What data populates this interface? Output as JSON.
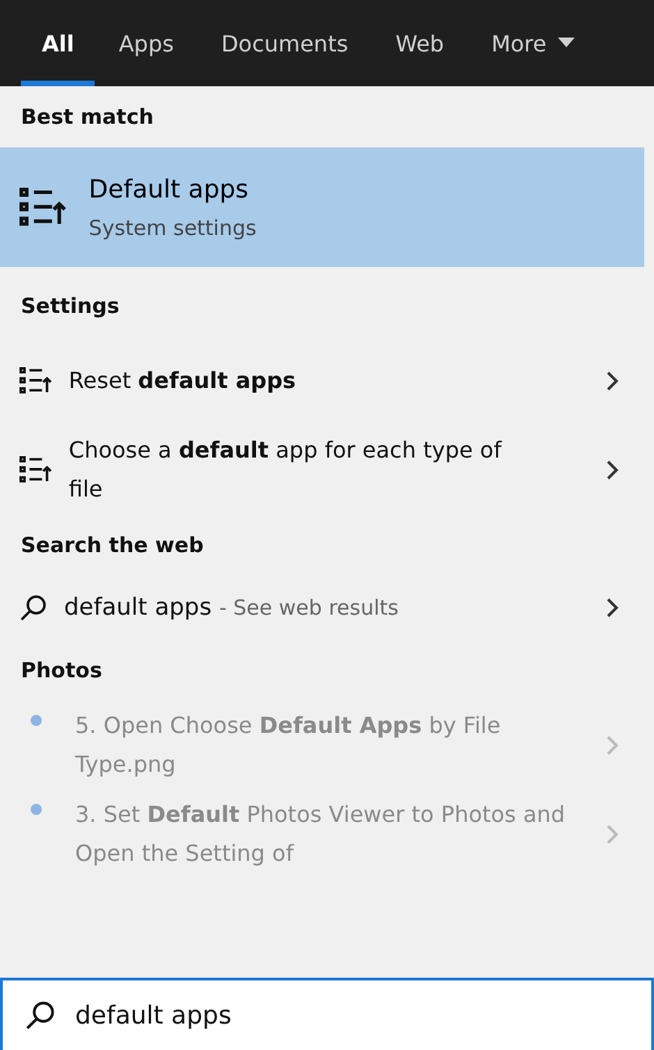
{
  "tabs": [
    {
      "label": "All",
      "selected": true
    },
    {
      "label": "Apps",
      "selected": false
    },
    {
      "label": "Documents",
      "selected": false
    },
    {
      "label": "Web",
      "selected": false
    },
    {
      "label": "More",
      "selected": false,
      "dropdown": true
    }
  ],
  "best_match": {
    "heading": "Best match",
    "title": "Default apps",
    "subtitle": "System settings"
  },
  "sections": [
    {
      "heading": "Settings",
      "items": [
        {
          "kind": "setting",
          "text": "Reset **default apps**"
        },
        {
          "kind": "setting",
          "text": "Choose a **default** app for each type of file"
        }
      ]
    },
    {
      "heading": "Search the web",
      "items": [
        {
          "kind": "web",
          "text": "default apps",
          "suffix": "- See web results"
        }
      ]
    },
    {
      "heading": "Photos",
      "items": [
        {
          "kind": "photo",
          "text": "5. Open Choose **Default Apps** by File Type.png"
        },
        {
          "kind": "photo",
          "text": "3. Set **Default** Photos Viewer to Photos and Open the Setting of"
        }
      ]
    }
  ],
  "search": {
    "value": "default apps"
  }
}
